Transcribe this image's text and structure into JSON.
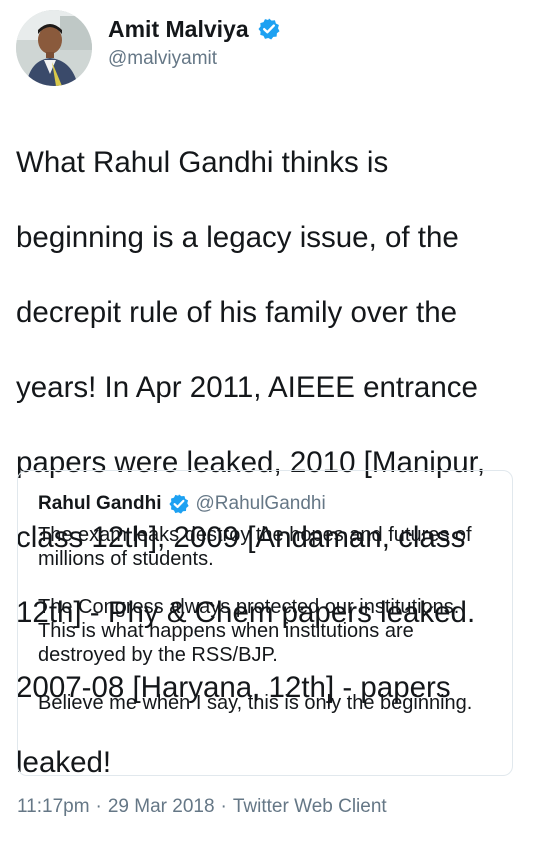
{
  "tweet": {
    "author": {
      "display_name": "Amit Malviya",
      "handle": "@malviyamit",
      "verified_icon": "verified-badge-icon"
    },
    "text_lines": [
      "What Rahul Gandhi thinks is",
      "beginning is a legacy issue, of the",
      "decrepit rule of his family over the",
      "years! In Apr 2011, AIEEE entrance",
      "papers were leaked, 2010 [Manipur,",
      "class 12th], 2009 [Andaman, class",
      "12th] - Phy & Chem papers leaked.",
      "2007-08 [Haryana, 12th] - papers",
      "leaked!"
    ],
    "quoted": {
      "display_name": "Rahul Gandhi",
      "handle": "@RahulGandhi",
      "verified_icon": "verified-badge-icon",
      "paragraph_1": "The exam leaks destroy the hopes and futures of millions of students.",
      "paragraph_2": "The Congress always protected our institutions. This is what happens when institutions are destroyed by the RSS/BJP.",
      "paragraph_3": "Believe me when I say, this is only the beginning."
    },
    "time": "11:17pm",
    "separator": "·",
    "date": "29 Mar 2018",
    "client": "Twitter Web Client"
  },
  "colors": {
    "verified": "#1da1f2",
    "secondary_text": "#657786",
    "primary_text": "#14171a",
    "border": "#e1e8ed"
  }
}
